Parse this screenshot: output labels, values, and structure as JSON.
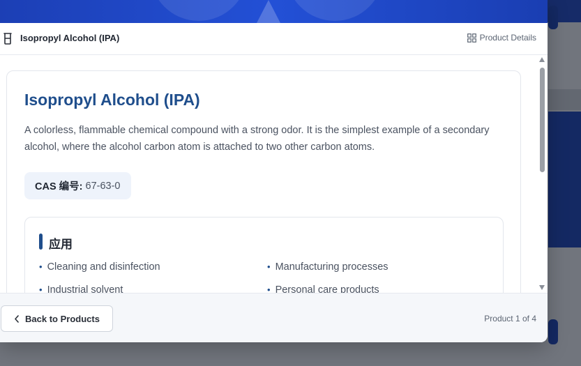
{
  "header": {
    "title": "Isopropyl Alcohol (IPA)",
    "details_label": "Product Details"
  },
  "product": {
    "name": "Isopropyl Alcohol (IPA)",
    "description": "A colorless, flammable chemical compound with a strong odor. It is the simplest example of a secondary alcohol, where the alcohol carbon atom is attached to two other carbon atoms.",
    "cas_label": "CAS 编号:",
    "cas_value": "67-63-0"
  },
  "applications": {
    "heading": "应用",
    "items": [
      "Cleaning and disinfection",
      "Manufacturing processes",
      "Industrial solvent",
      "Personal care products"
    ]
  },
  "footer": {
    "back_label": "Back to Products",
    "counter": "Product 1 of 4"
  },
  "colors": {
    "accent": "#1f4e8c",
    "hero": "#2350d6"
  }
}
